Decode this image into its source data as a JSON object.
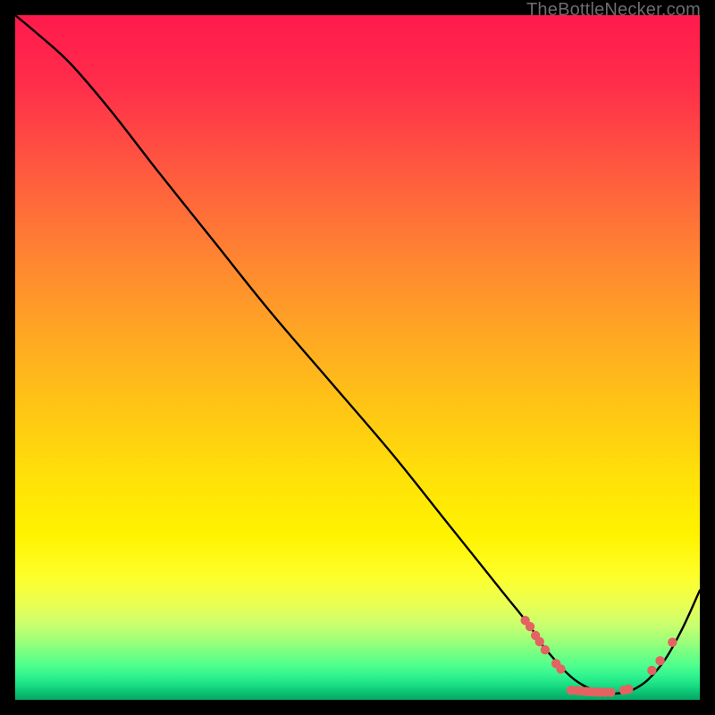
{
  "watermark": "TheBottleNecker.com",
  "colors": {
    "curve": "#000000",
    "markers": "#e46262",
    "background": "#000000"
  },
  "chart_data": {
    "type": "line",
    "title": "",
    "xlabel": "",
    "ylabel": "",
    "xlim": [
      0,
      100
    ],
    "ylim": [
      0,
      100
    ],
    "grid": false,
    "series": [
      {
        "name": "curve",
        "x": [
          0,
          3,
          8,
          14,
          21,
          29,
          37,
          46,
          55,
          63,
          71,
          75,
          77,
          78.5,
          80,
          81.5,
          83,
          84.5,
          86,
          87.5,
          89,
          90.5,
          92.5,
          95,
          97.5,
          100
        ],
        "y": [
          100,
          97.5,
          93,
          86,
          77,
          67,
          57,
          46.5,
          36,
          26,
          16,
          11,
          8,
          6.2,
          4.5,
          3.1,
          2.1,
          1.4,
          1.0,
          0.9,
          1.1,
          1.6,
          3.0,
          6,
          10.5,
          16
        ]
      }
    ],
    "markers": [
      {
        "x": 74.5,
        "y": 11.6
      },
      {
        "x": 75.2,
        "y": 10.7
      },
      {
        "x": 76.0,
        "y": 9.4
      },
      {
        "x": 76.6,
        "y": 8.5
      },
      {
        "x": 77.4,
        "y": 7.3
      },
      {
        "x": 79.0,
        "y": 5.3
      },
      {
        "x": 79.7,
        "y": 4.5
      },
      {
        "x": 81.2,
        "y": 1.4
      },
      {
        "x": 82.0,
        "y": 1.35
      },
      {
        "x": 82.7,
        "y": 1.28
      },
      {
        "x": 83.4,
        "y": 1.22
      },
      {
        "x": 84.1,
        "y": 1.18
      },
      {
        "x": 84.8,
        "y": 1.14
      },
      {
        "x": 85.5,
        "y": 1.12
      },
      {
        "x": 86.2,
        "y": 1.1
      },
      {
        "x": 87.0,
        "y": 1.1
      },
      {
        "x": 88.9,
        "y": 1.4
      },
      {
        "x": 89.6,
        "y": 1.55
      },
      {
        "x": 93.0,
        "y": 4.3
      },
      {
        "x": 94.2,
        "y": 5.7
      },
      {
        "x": 96.0,
        "y": 8.4
      }
    ]
  }
}
